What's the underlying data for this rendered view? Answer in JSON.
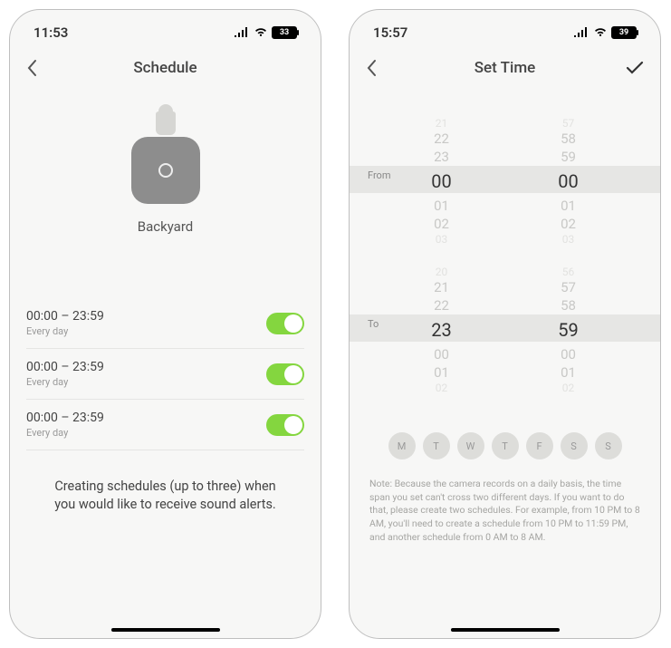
{
  "left": {
    "status": {
      "time": "11:53",
      "battery": "33"
    },
    "nav": {
      "title": "Schedule"
    },
    "camera": {
      "name": "Backyard"
    },
    "schedules": [
      {
        "time_range": "00:00 – 23:59",
        "frequency": "Every day",
        "enabled": true
      },
      {
        "time_range": "00:00 – 23:59",
        "frequency": "Every day",
        "enabled": true
      },
      {
        "time_range": "00:00 – 23:59",
        "frequency": "Every day",
        "enabled": true
      }
    ],
    "help": "Creating schedules (up to three) when you would like to receive sound alerts."
  },
  "right": {
    "status": {
      "time": "15:57",
      "battery": "39"
    },
    "nav": {
      "title": "Set Time"
    },
    "picker": {
      "from_label": "From",
      "to_label": "To",
      "from": {
        "hours_context": [
          "21",
          "22",
          "23"
        ],
        "hours_sel": "00",
        "hours_after": [
          "01",
          "02",
          "03"
        ],
        "mins_context": [
          "57",
          "58",
          "59"
        ],
        "mins_sel": "00",
        "mins_after": [
          "01",
          "02",
          "03"
        ]
      },
      "to": {
        "hours_context": [
          "20",
          "21",
          "22"
        ],
        "hours_sel": "23",
        "hours_after": [
          "00",
          "01",
          "02"
        ],
        "mins_context": [
          "56",
          "57",
          "58"
        ],
        "mins_sel": "59",
        "mins_after": [
          "00",
          "01",
          "02"
        ]
      }
    },
    "days": [
      "M",
      "T",
      "W",
      "T",
      "F",
      "S",
      "S"
    ],
    "note": "Note: Because the camera records on a daily basis, the time span you set can't cross two different days. If you want to do that, please create two schedules. For example, from 10 PM to 8 AM, you'll need to create a schedule from 10 PM to 11:59 PM, and another schedule from 0 AM to 8 AM."
  }
}
